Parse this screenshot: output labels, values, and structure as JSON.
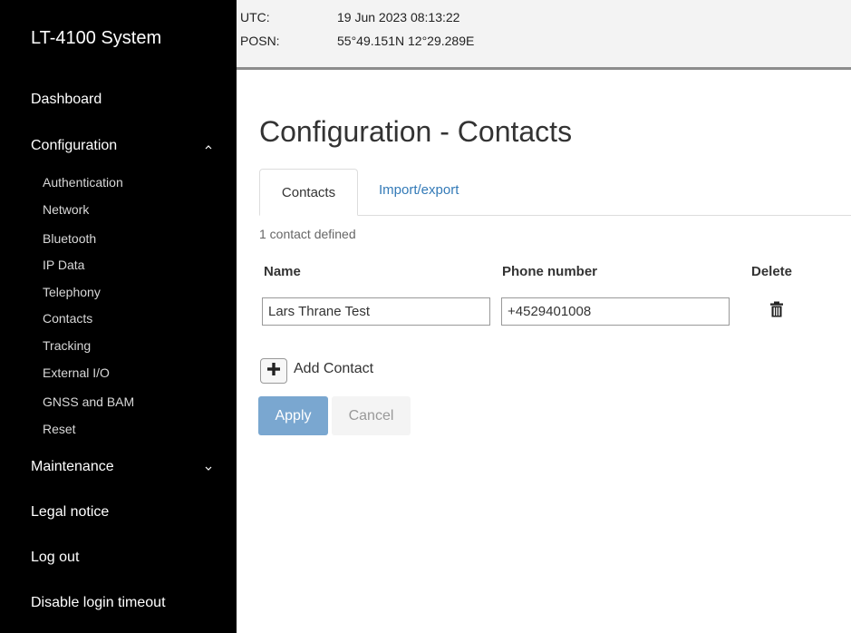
{
  "sidebar": {
    "brand": "LT-4100 System",
    "dashboard": "Dashboard",
    "configuration": "Configuration",
    "config_items": [
      "Authentication",
      "Network",
      "Bluetooth",
      "IP Data",
      "Telephony",
      "Contacts",
      "Tracking",
      "External I/O",
      "GNSS and BAM",
      "Reset"
    ],
    "maintenance": "Maintenance",
    "legal_notice": "Legal notice",
    "log_out": "Log out",
    "disable_login_timeout": "Disable login timeout"
  },
  "status": {
    "utc_label": "UTC:",
    "utc_value": "19 Jun 2023 08:13:22",
    "posn_label": "POSN:",
    "posn_value": "55°49.151N 12°29.289E"
  },
  "main": {
    "title": "Configuration - Contacts",
    "tabs": [
      {
        "label": "Contacts",
        "active": true
      },
      {
        "label": "Import/export",
        "active": false
      }
    ],
    "count_text": "1 contact defined",
    "columns": {
      "name": "Name",
      "phone": "Phone number",
      "delete": "Delete"
    },
    "contacts": [
      {
        "name": "Lars Thrane Test",
        "phone": "+4529401008"
      }
    ],
    "add_contact_label": "Add Contact",
    "apply_label": "Apply",
    "cancel_label": "Cancel"
  },
  "icons": {
    "configuration_chevron": "chevron-up-icon",
    "maintenance_chevron": "chevron-down-icon",
    "delete": "trash-icon",
    "add": "plus-icon"
  },
  "colors": {
    "sidebar_bg": "#000000",
    "link": "#337ab7",
    "apply_bg": "#7aa7d0"
  }
}
